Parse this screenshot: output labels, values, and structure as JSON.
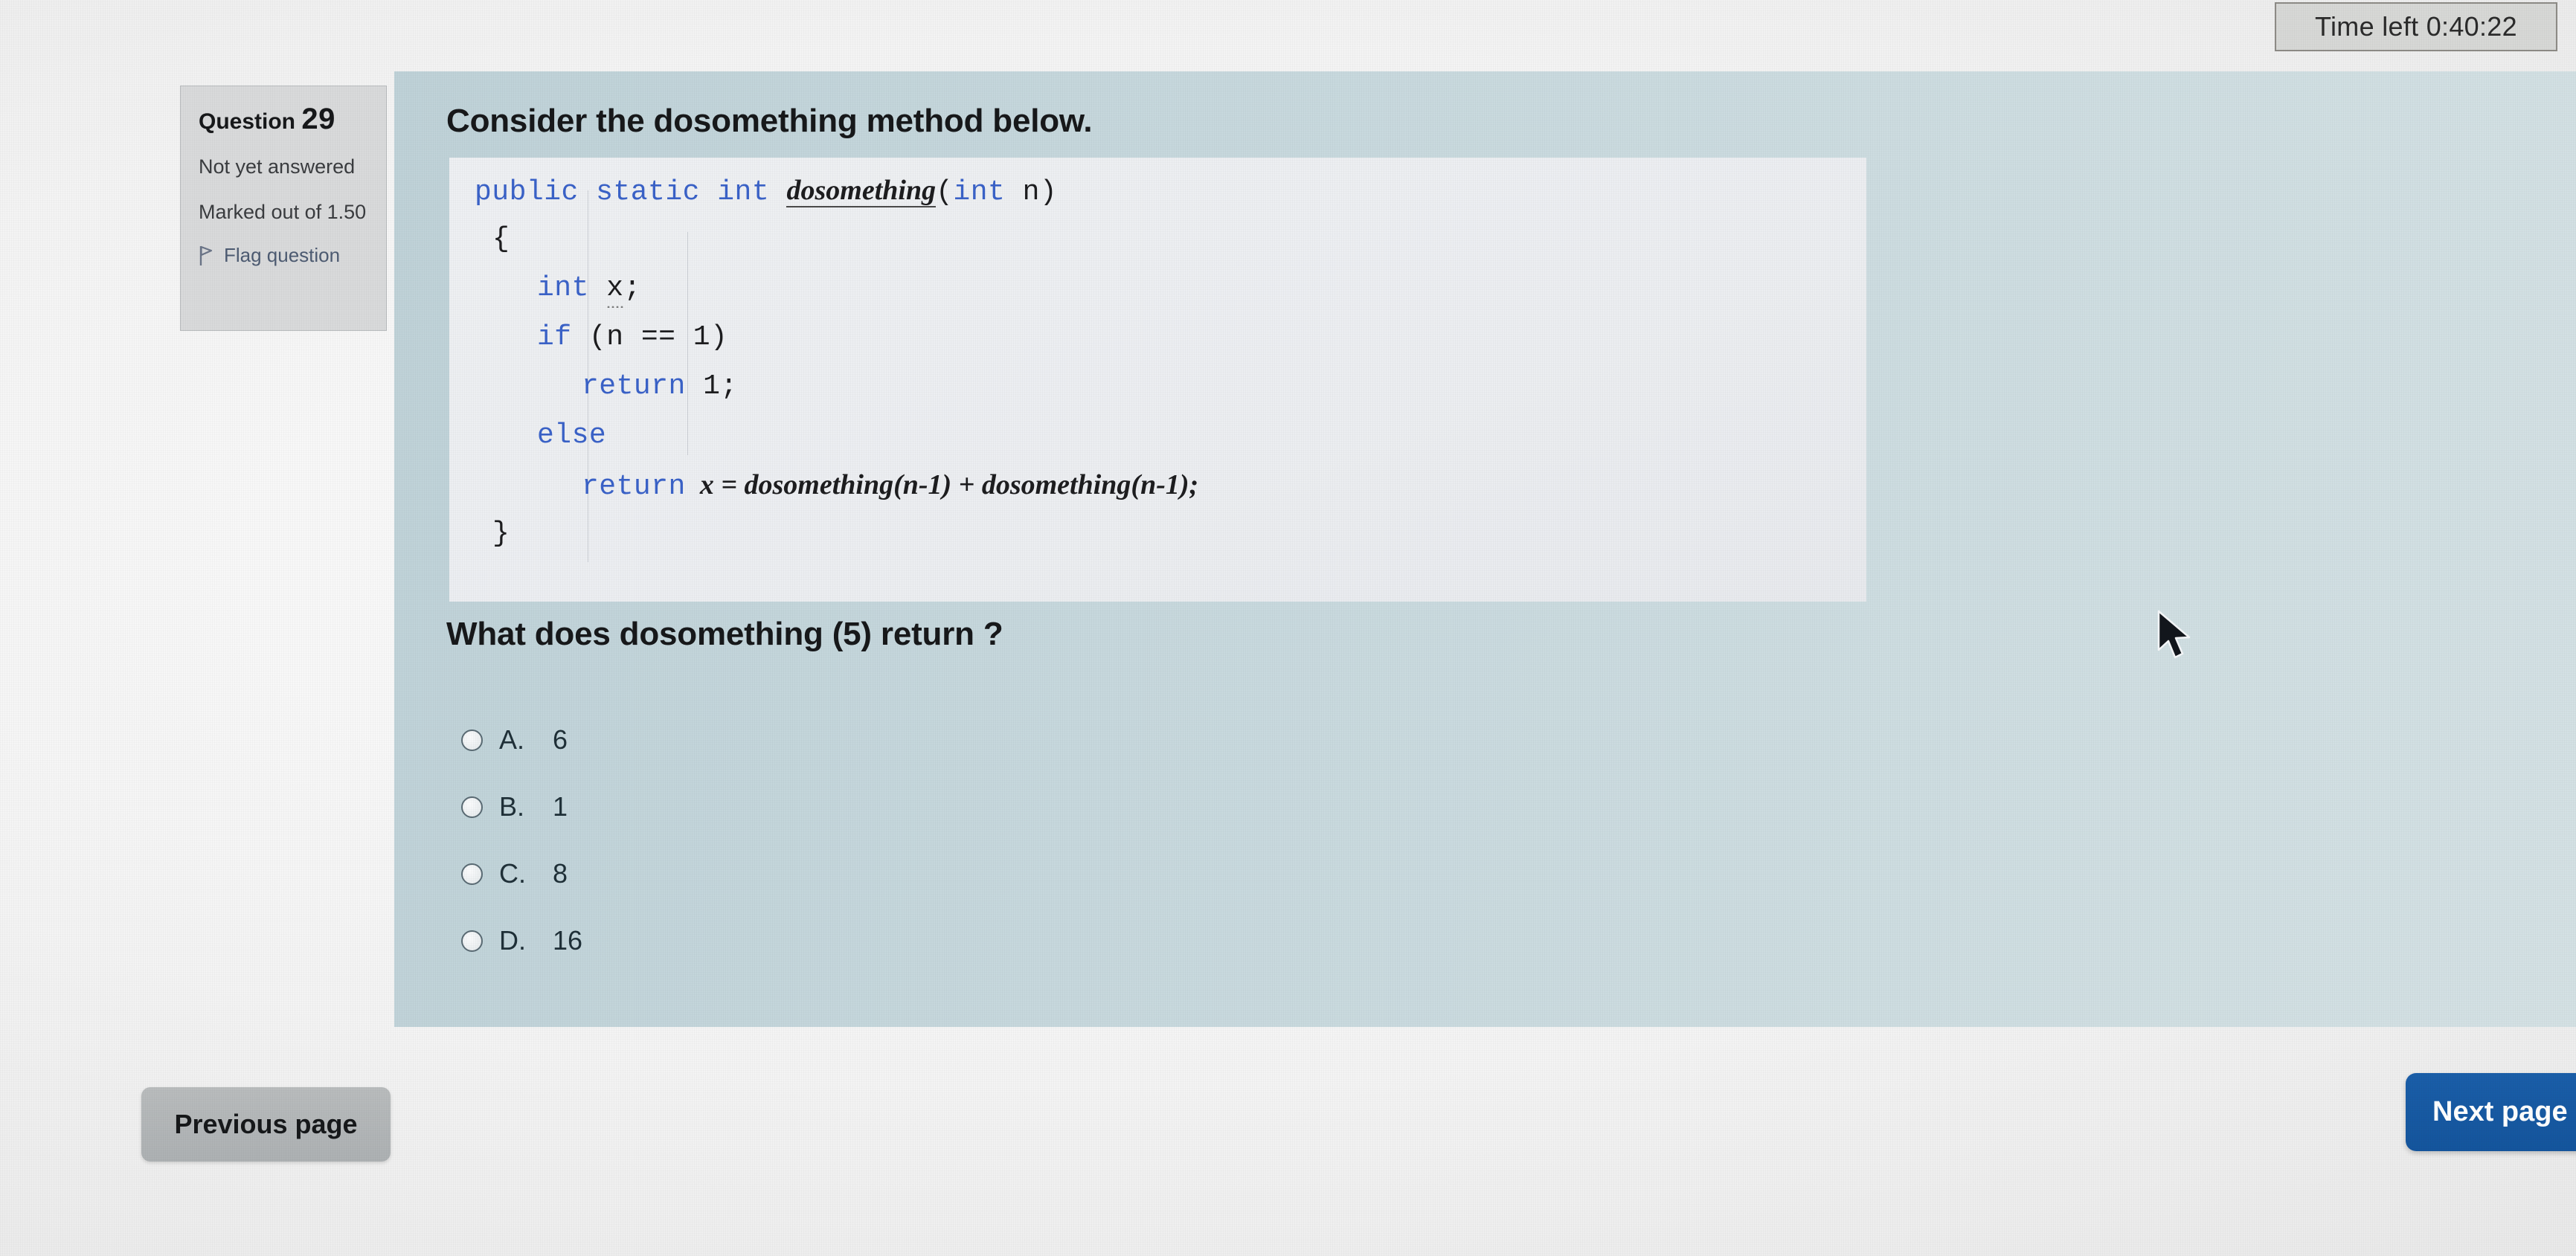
{
  "timer": {
    "label": "Time left 0:40:22"
  },
  "question_info": {
    "title_prefix": "Question",
    "number": "29",
    "status": "Not yet answered",
    "marked_out_of": "Marked out of 1.50",
    "flag_label": "Flag question",
    "flag_icon": "flag-icon"
  },
  "question": {
    "heading": "Consider the dosomething method below.",
    "prompt": "What does dosomething (5) return ?",
    "code_lines": {
      "l1_kw": "public static int",
      "l1_name": "dosomething",
      "l1_paren_open": "(",
      "l1_int": "int",
      "l1_arg": " n)",
      "l2": "{",
      "l3_kw": "int",
      "l3_var": "x",
      "l3_semi": ";",
      "l4_kw": "if",
      "l4_rest": " (n == 1)",
      "l5_kw": "return",
      "l5_rest": " 1;",
      "l6_kw": "else",
      "l7_kw": "return",
      "l7_rest": "  x = dosomething(n-1) + dosomething(n-1);",
      "l8": "}"
    }
  },
  "answers": {
    "options": [
      {
        "letter": "A.",
        "value": "6",
        "selected": false
      },
      {
        "letter": "B.",
        "value": "1",
        "selected": false
      },
      {
        "letter": "C.",
        "value": "8",
        "selected": false
      },
      {
        "letter": "D.",
        "value": "16",
        "selected": false
      }
    ]
  },
  "navigation": {
    "previous_label": "Previous page",
    "next_label": "Next page"
  },
  "colors": {
    "panel_background": "#c7d8dd",
    "code_background": "#eceef1",
    "keyword_blue": "#3a62c8",
    "next_button_blue": "#1a5ea9",
    "previous_button_gray": "#b2b6b8",
    "link_blue": "#4d5b72"
  }
}
